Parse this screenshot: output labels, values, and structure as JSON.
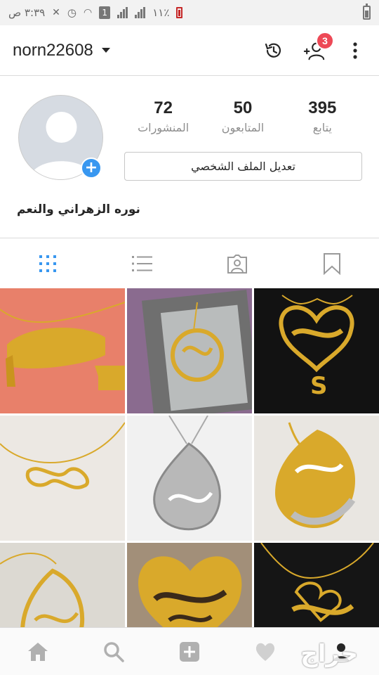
{
  "status_bar": {
    "time": "٣:٣٩ ص",
    "battery_percent": "١١٪",
    "sim_label": "1"
  },
  "header": {
    "username": "norn22608",
    "notification_count": "3"
  },
  "profile": {
    "display_name": "نوره الزهراني والنعم",
    "stats": [
      {
        "value": "72",
        "label": "المنشورات"
      },
      {
        "value": "50",
        "label": "المتابعون"
      },
      {
        "value": "395",
        "label": "يتابع"
      }
    ],
    "edit_button_label": "تعديل الملف الشخصي"
  },
  "tabs": [
    {
      "icon": "grid-icon",
      "active": true
    },
    {
      "icon": "list-icon",
      "active": false
    },
    {
      "icon": "tagged-icon",
      "active": false
    },
    {
      "icon": "bookmark-icon",
      "active": false
    }
  ],
  "posts": [
    {
      "alt": "necklace-1"
    },
    {
      "alt": "necklace-2"
    },
    {
      "alt": "necklace-3"
    },
    {
      "alt": "necklace-4"
    },
    {
      "alt": "necklace-5"
    },
    {
      "alt": "necklace-6"
    },
    {
      "alt": "necklace-7"
    },
    {
      "alt": "necklace-8"
    },
    {
      "alt": "necklace-9"
    }
  ],
  "bottom_nav": [
    {
      "icon": "home-icon"
    },
    {
      "icon": "search-icon"
    },
    {
      "icon": "add-post-icon"
    },
    {
      "icon": "heart-icon"
    },
    {
      "icon": "profile-icon"
    }
  ],
  "watermark": "حراج",
  "colors": {
    "accent_blue": "#3897f0",
    "badge_red": "#ed4956",
    "gold": "#d9a92b"
  }
}
